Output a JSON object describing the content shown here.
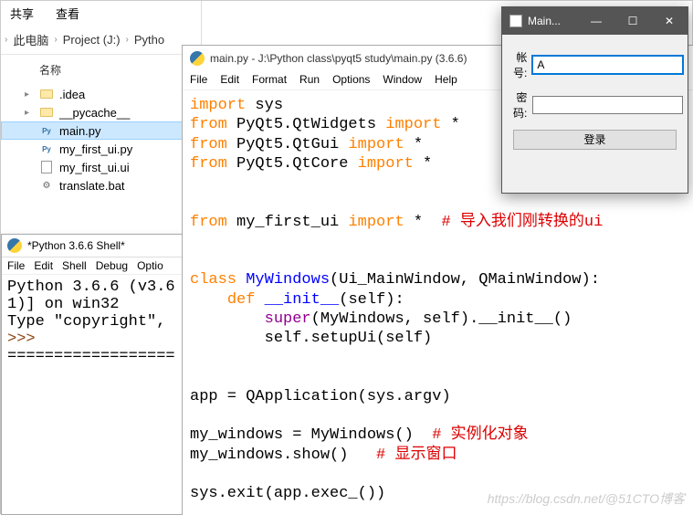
{
  "explorer": {
    "tabs": [
      "共享",
      "查看"
    ],
    "crumbs": [
      "此电脑",
      "Project (J:)",
      "Pytho"
    ],
    "header": "名称",
    "items": [
      {
        "name": ".idea",
        "type": "folder"
      },
      {
        "name": "__pycache__",
        "type": "folder"
      },
      {
        "name": "main.py",
        "type": "py",
        "selected": true
      },
      {
        "name": "my_first_ui.py",
        "type": "py"
      },
      {
        "name": "my_first_ui.ui",
        "type": "ui"
      },
      {
        "name": "translate.bat",
        "type": "bat"
      }
    ]
  },
  "shell": {
    "title": "*Python 3.6.6 Shell*",
    "menu": [
      "File",
      "Edit",
      "Shell",
      "Debug",
      "Optio"
    ],
    "lines": {
      "l1": "Python 3.6.6 (v3.6",
      "l2": "1)] on win32",
      "l3": "Type \"copyright\",",
      "prompt": ">>> ",
      "sep": "================== R"
    }
  },
  "editor": {
    "title": "main.py - J:\\Python class\\pyqt5 study\\main.py (3.6.6)",
    "menu": [
      "File",
      "Edit",
      "Format",
      "Run",
      "Options",
      "Window",
      "Help"
    ],
    "code": {
      "t_import": "import",
      "t_from": "from",
      "t_class": "class",
      "t_def": "def",
      "t_super": "super",
      "sys": " sys",
      "pq_widgets": " PyQt5.QtWidgets ",
      "pq_gui": " PyQt5.QtGui ",
      "pq_core": " PyQt5.QtCore ",
      "star": " *",
      "from_ui": " my_first_ui ",
      "cmt_ui": "  # 导入我们刚转换的ui",
      "cls": " MyWindows",
      "cls_args": "(Ui_MainWindow, QMainWindow):",
      "def_init": " __init__",
      "def_args": "(self):",
      "super_call": "(MyWindows, self).__init__()",
      "setup": "        self.setupUi(self)",
      "app_assign": "app = QApplication(sys.argv)",
      "mw_assign": "my_windows = MyWindows()  ",
      "cmt_inst": "# 实例化对象",
      "mw_show": "my_windows.show()   ",
      "cmt_show": "# 显示窗口",
      "exit": "sys.exit(app.exec_())"
    }
  },
  "app": {
    "title": "Main...",
    "labels": {
      "user": "帐号:",
      "pass": "密码:"
    },
    "user_value": "A",
    "pass_value": "",
    "login": "登录",
    "winbtn": {
      "min": "—",
      "max": "☐",
      "close": "✕"
    }
  },
  "watermark": "https://blog.csdn.net/@51CTO博客"
}
